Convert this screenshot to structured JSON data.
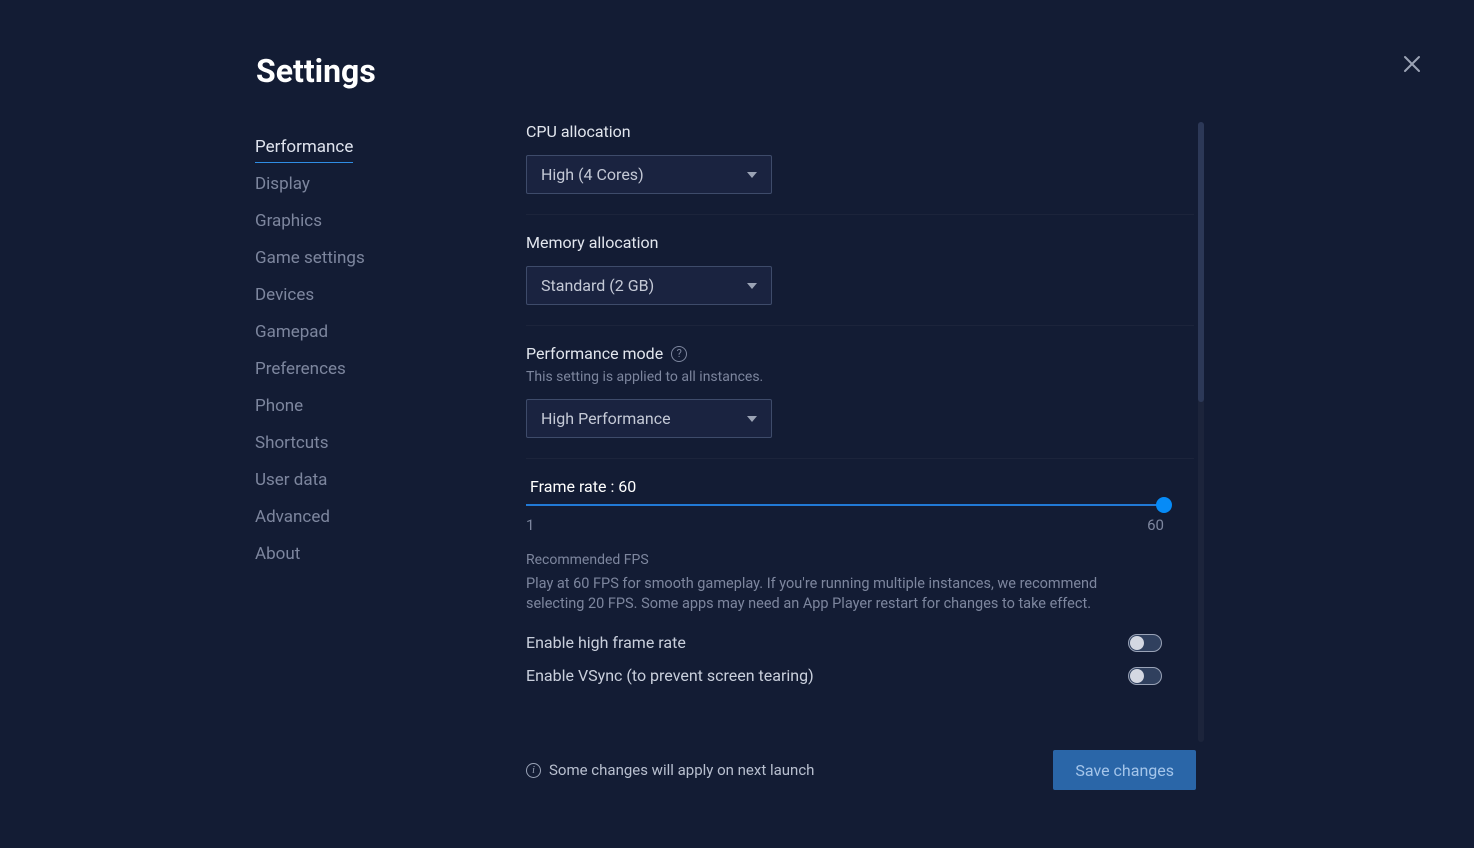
{
  "page_title": "Settings",
  "sidebar": {
    "items": [
      "Performance",
      "Display",
      "Graphics",
      "Game settings",
      "Devices",
      "Gamepad",
      "Preferences",
      "Phone",
      "Shortcuts",
      "User data",
      "Advanced",
      "About"
    ],
    "active_index": 0
  },
  "cpu": {
    "label": "CPU allocation",
    "value": "High (4 Cores)"
  },
  "memory": {
    "label": "Memory allocation",
    "value": "Standard (2 GB)"
  },
  "performance_mode": {
    "label": "Performance mode",
    "hint": "This setting is applied to all instances.",
    "value": "High Performance"
  },
  "frame_rate": {
    "prefix": "Frame rate : ",
    "value": "60",
    "min": "1",
    "max": "60",
    "recommended_title": "Recommended FPS",
    "recommended_text": "Play at 60 FPS for smooth gameplay. If you're running multiple instances, we recommend selecting 20 FPS. Some apps may need an App Player restart for changes to take effect."
  },
  "toggles": {
    "high_frame_rate": "Enable high frame rate",
    "vsync": "Enable VSync (to prevent screen tearing)"
  },
  "footer": {
    "hint": "Some changes will apply on next launch",
    "save": "Save changes"
  }
}
